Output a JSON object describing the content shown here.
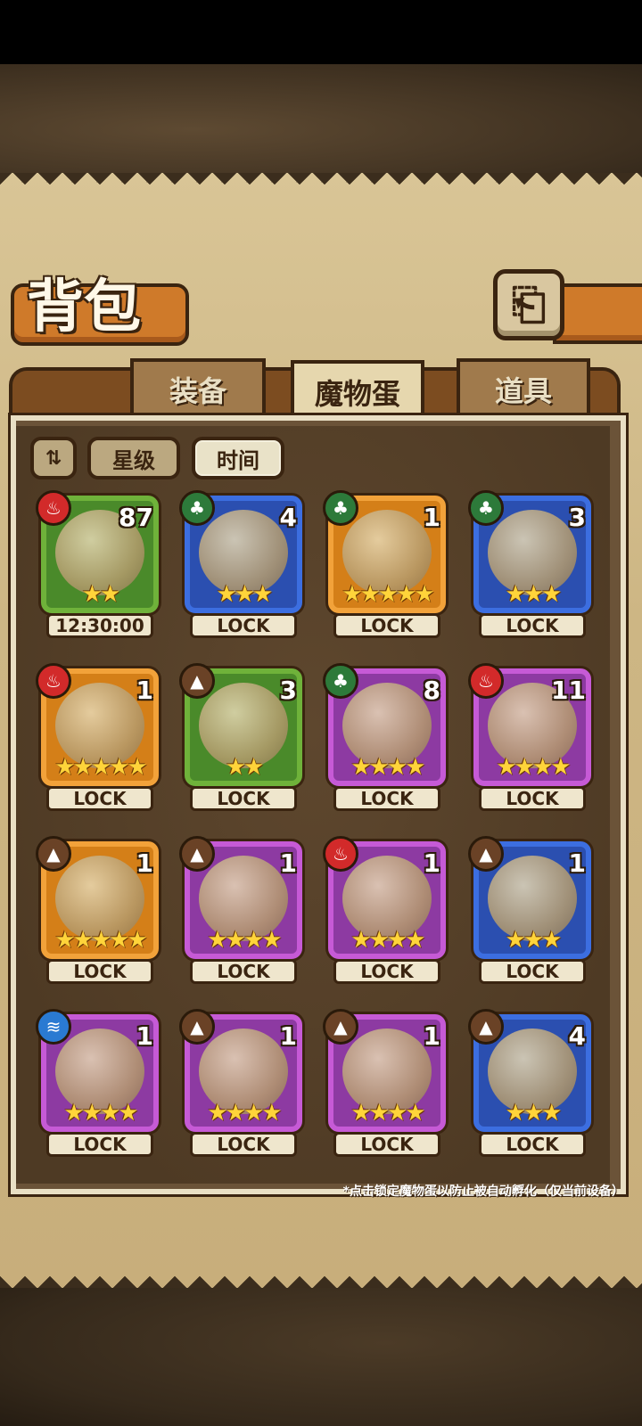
{
  "header": {
    "title": "背包",
    "back_icon": "⎗"
  },
  "tabs": [
    {
      "label": "装备",
      "active": false
    },
    {
      "label": "魔物蛋",
      "active": true
    },
    {
      "label": "道具",
      "active": false
    }
  ],
  "sort": {
    "toggle_icon": "⇅",
    "star_label": "星级",
    "time_label": "时间",
    "active": "时间"
  },
  "eggs": [
    {
      "element": "fire",
      "rarity": "green",
      "count": "87",
      "stars": "★★",
      "label": "12:30:00"
    },
    {
      "element": "grass",
      "rarity": "blue",
      "count": "4",
      "stars": "★★★",
      "label": "LOCK"
    },
    {
      "element": "grass",
      "rarity": "orange",
      "count": "1",
      "stars": "★★★★★",
      "label": "LOCK"
    },
    {
      "element": "grass",
      "rarity": "blue",
      "count": "3",
      "stars": "★★★",
      "label": "LOCK"
    },
    {
      "element": "fire",
      "rarity": "orange",
      "count": "1",
      "stars": "★★★★★",
      "label": "LOCK"
    },
    {
      "element": "earth",
      "rarity": "green",
      "count": "3",
      "stars": "★★",
      "label": "LOCK"
    },
    {
      "element": "grass",
      "rarity": "purple",
      "count": "8",
      "stars": "★★★★",
      "label": "LOCK"
    },
    {
      "element": "fire",
      "rarity": "purple",
      "count": "11",
      "stars": "★★★★",
      "label": "LOCK"
    },
    {
      "element": "earth",
      "rarity": "orange",
      "count": "1",
      "stars": "★★★★★",
      "label": "LOCK"
    },
    {
      "element": "earth",
      "rarity": "purple",
      "count": "1",
      "stars": "★★★★",
      "label": "LOCK"
    },
    {
      "element": "fire",
      "rarity": "purple",
      "count": "1",
      "stars": "★★★★",
      "label": "LOCK"
    },
    {
      "element": "earth",
      "rarity": "blue",
      "count": "1",
      "stars": "★★★",
      "label": "LOCK"
    },
    {
      "element": "water",
      "rarity": "purple",
      "count": "1",
      "stars": "★★★★",
      "label": "LOCK"
    },
    {
      "element": "earth",
      "rarity": "purple",
      "count": "1",
      "stars": "★★★★",
      "label": "LOCK"
    },
    {
      "element": "earth",
      "rarity": "purple",
      "count": "1",
      "stars": "★★★★",
      "label": "LOCK"
    },
    {
      "element": "earth",
      "rarity": "blue",
      "count": "4",
      "stars": "★★★",
      "label": "LOCK"
    }
  ],
  "element_icons": {
    "fire": "♨",
    "grass": "♣",
    "earth": "▲",
    "water": "≋"
  },
  "footnote": "*点击锁定魔物蛋以防止被自动孵化（仅当前设备）"
}
